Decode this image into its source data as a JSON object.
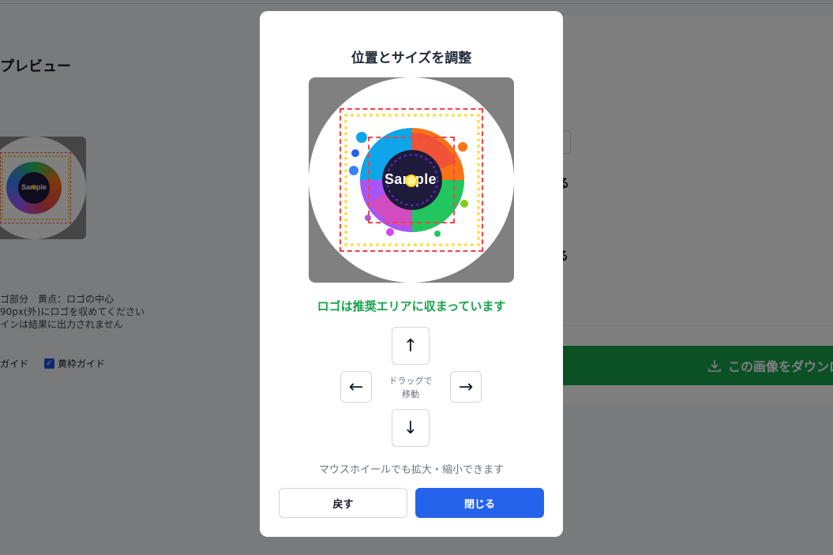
{
  "background": {
    "title": "プレビュー",
    "notes": [
      "ゴ部分　黄点：ロゴの中心",
      "90px(外)にロゴを収めてください",
      "インは結果に出力されません"
    ],
    "checkboxes": [
      {
        "label": "ガイド",
        "checked": true
      },
      {
        "label": "黄枠ガイド",
        "checked": true
      }
    ],
    "right_text_1": "る",
    "right_text_2": "する",
    "download_button": "この画像をダウンロ"
  },
  "modal": {
    "title": "位置とサイズを調整",
    "logo_text": "Sample",
    "status": "ロゴは推奨エリアに収まっています",
    "arrows": {
      "up": "↑",
      "down": "↓",
      "left": "←",
      "right": "→"
    },
    "drag_hint_line1": "ドラッグで",
    "drag_hint_line2": "移動",
    "wheel_hint": "マウスホイールでも拡大・縮小できます",
    "back_button": "戻す",
    "close_button": "閉じる"
  },
  "colors": {
    "primary": "#2563eb",
    "success": "#16a34a",
    "guide_red": "#ef4444",
    "guide_yellow": "#fde047"
  }
}
